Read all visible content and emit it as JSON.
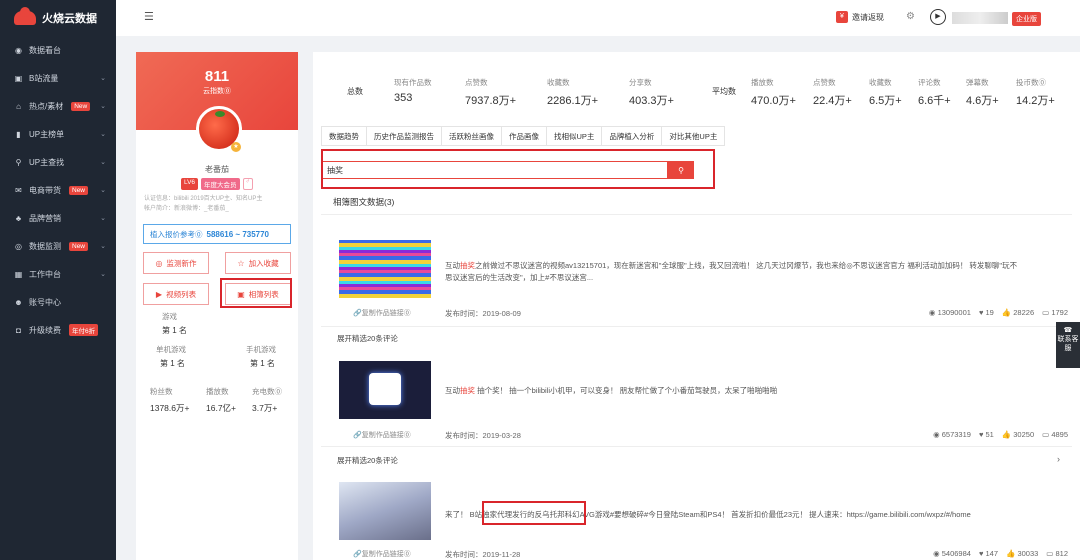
{
  "brand": {
    "name": "火烧云数据"
  },
  "sidebar": {
    "items": [
      {
        "label": "数据看台",
        "icon": "dashboard-icon",
        "glyph": "◉",
        "caret": false,
        "new": false
      },
      {
        "label": "B站流量",
        "icon": "monitor-icon",
        "glyph": "▣",
        "caret": true,
        "new": false
      },
      {
        "label": "热点/素材",
        "icon": "home-icon",
        "glyph": "⌂",
        "caret": true,
        "new": true
      },
      {
        "label": "UP主榜单",
        "icon": "bar-chart-icon",
        "glyph": "▮",
        "caret": true,
        "new": false
      },
      {
        "label": "UP主查找",
        "icon": "search-icon",
        "glyph": "⚲",
        "caret": true,
        "new": false
      },
      {
        "label": "电商带货",
        "icon": "mail-icon",
        "glyph": "✉",
        "caret": true,
        "new": true
      },
      {
        "label": "品牌营销",
        "icon": "group-icon",
        "glyph": "♣",
        "caret": true,
        "new": false
      },
      {
        "label": "数据监测",
        "icon": "target-icon",
        "glyph": "◎",
        "caret": true,
        "new": true
      },
      {
        "label": "工作中台",
        "icon": "grid-icon",
        "glyph": "▦",
        "caret": true,
        "new": false
      },
      {
        "label": "账号中心",
        "icon": "user-icon",
        "glyph": "☻",
        "caret": false,
        "new": false
      },
      {
        "label": "升级续费",
        "icon": "upgrade-icon",
        "glyph": "◘",
        "caret": false,
        "new": false,
        "badge": "年付6折"
      }
    ],
    "new_label": "New"
  },
  "topbar": {
    "invite_label": "邀请返现",
    "enterprise_label": "企业版"
  },
  "profile": {
    "score": "811",
    "score_label": "云指数⓪",
    "name": "老番茄",
    "level": "LV6",
    "vip": "年度大会员",
    "auth_line1": "认证信息：bilibili 2019百大UP主、知名UP主",
    "auth_line2": "帐户简介：新浪微博：_老番茄_",
    "quote_label": "植入报价参考⓪",
    "quote_value": "588616 ~ 735770",
    "btn_monitor": "监测新作",
    "btn_collect": "加入收藏",
    "btn_video_list": "视频列表",
    "btn_article_list": "相簿列表",
    "rank_category": "游戏",
    "rank_category_val": "第 1 名",
    "rank_single": "单机游戏",
    "rank_single_val": "第 1 名",
    "rank_mobile": "手机游戏",
    "rank_mobile_val": "第 1 名",
    "fans_label": "粉丝数",
    "fans_val": "1378.6万+",
    "plays_label": "播放数",
    "plays_val": "16.7亿+",
    "charge_label": "充电数⓪",
    "charge_val": "3.7万+"
  },
  "totals": {
    "title": "总数",
    "works_label": "现有作品数",
    "works_val": "353",
    "likes_label": "点赞数",
    "likes_val": "7937.8万+",
    "fav_label": "收藏数",
    "fav_val": "2286.1万+",
    "share_label": "分享数",
    "share_val": "403.3万+"
  },
  "averages": {
    "title": "平均数",
    "play_label": "播放数",
    "play_val": "470.0万+",
    "like_label": "点赞数",
    "like_val": "22.4万+",
    "fav_label": "收藏数",
    "fav_val": "6.5万+",
    "comment_label": "评论数",
    "comment_val": "6.6千+",
    "danmu_label": "弹幕数",
    "danmu_val": "4.6万+",
    "coin_label": "投币数⓪",
    "coin_val": "14.2万+"
  },
  "tabs": [
    "数据趋势",
    "历史作品监测报告",
    "活跃粉丝画像",
    "作品画像",
    "找相似UP主",
    "品牌植入分析",
    "对比其他UP主"
  ],
  "search": {
    "value": "抽奖"
  },
  "section_title": "相簿图文数据(3)",
  "items": [
    {
      "prefix": "互动",
      "highlight": "抽奖",
      "text1": "之前做过不思议迷宫的视频av13215701，现在新迷宫和\"全球服\"上线，我又回流啦！ 这几天过冈爆节，我也来给◎不思议迷宫官方 福利活动加加码！ 转发聊聊\"玩不",
      "text2": "思议迷宫后的生活改变\"，加上#不思议迷宫...",
      "copy": "复制作品链接⓪",
      "date": "发布时间：2019-08-09",
      "views": "13090001",
      "coins": "19",
      "likes": "28226",
      "comments": "1792"
    },
    {
      "prefix": "互动",
      "highlight": "抽奖",
      "text1": " 抽个奖！ 抽一个bilibili小机甲，可以变身！ 朋友帮忙做了个小番茄驾驶员，太呆了啪啪啪啪",
      "text2": "",
      "copy": "复制作品链接⓪",
      "date": "发布时间：2019-03-28",
      "views": "6573319",
      "coins": "51",
      "likes": "30250",
      "comments": "4895"
    },
    {
      "prefix": "",
      "highlight": "",
      "text1": "来了！ B站独家代理发行的反乌托邦科幻AVG游戏#要想破碎#今日登陆Steam和PS4！ 首发折扣价最低23元！ 提人速来：https://game.bilibili.com/wxpz/#/home",
      "text2": "",
      "copy": "复制作品链接⓪",
      "date": "发布时间：2019-11-28",
      "views": "5406984",
      "coins": "147",
      "likes": "30033",
      "comments": "812"
    }
  ],
  "expand_label": "展开精选20条评论",
  "service_label": "联系客服"
}
